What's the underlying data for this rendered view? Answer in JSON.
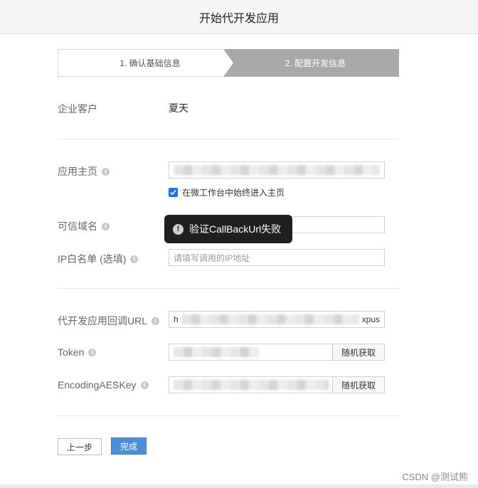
{
  "header": {
    "title": "开始代开发应用"
  },
  "steps": [
    {
      "label": "1. 确认基础信息"
    },
    {
      "label": "2. 配置开发信息"
    }
  ],
  "enterprise": {
    "label": "企业客户",
    "value": "夏天"
  },
  "homepage": {
    "label": "应用主页",
    "checkbox_label": "在微工作台中始终进入主页",
    "checked": true
  },
  "trusted_domain": {
    "label": "可信域名"
  },
  "ip_whitelist": {
    "label": "IP白名单 (选填)",
    "placeholder": "请填写调用的IP地址"
  },
  "callback_url": {
    "label": "代开发应用回调URL",
    "value_prefix": "h",
    "value_suffix": "xpus"
  },
  "token": {
    "label": "Token",
    "random_button": "随机获取"
  },
  "aes_key": {
    "label": "EncodingAESKey",
    "random_button": "随机获取"
  },
  "toast": {
    "message": "验证CallBackUrl失败"
  },
  "footer": {
    "prev_button": "上一步",
    "done_button": "完成"
  },
  "watermark": "CSDN @测试熊",
  "colors": {
    "primary": "#4a90d9",
    "toast_bg": "#1f1f1f",
    "active_step": "#a9a9a9"
  }
}
